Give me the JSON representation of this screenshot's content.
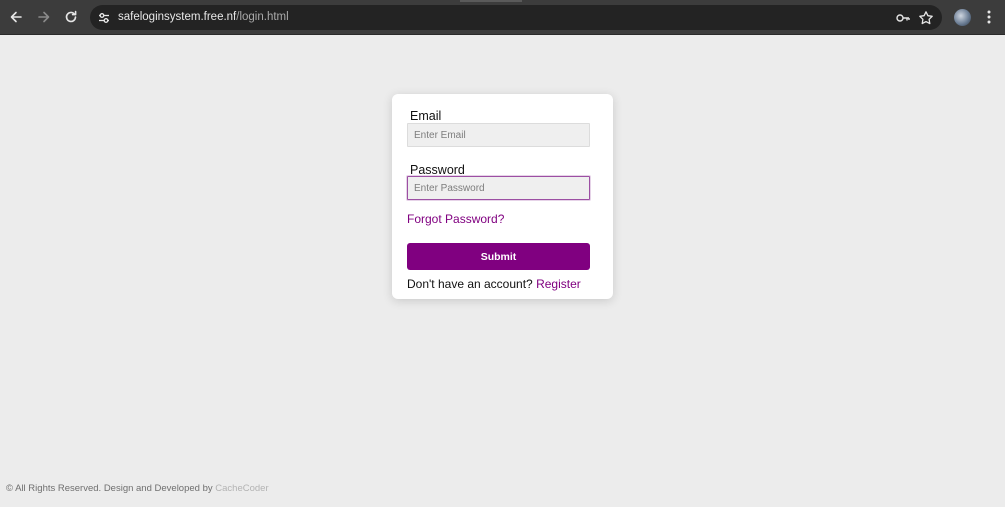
{
  "browser": {
    "url_host": "safeloginsystem.free.nf",
    "url_path": "/login.html",
    "icons": {
      "back": "arrow-left-icon",
      "forward": "arrow-right-icon",
      "reload": "reload-icon",
      "site_info": "tune-icon",
      "password": "key-icon",
      "bookmark": "star-icon",
      "profile": "avatar",
      "menu": "kebab-menu-icon"
    }
  },
  "login": {
    "email_label": "Email",
    "email_placeholder": "Enter Email",
    "email_value": "",
    "password_label": "Password",
    "password_placeholder": "Enter Password",
    "password_value": "",
    "forgot_label": "Forgot Password?",
    "submit_label": "Submit",
    "register_prompt": "Don't have an account?",
    "register_label": "Register"
  },
  "footer": {
    "text": "© All Rights Reserved. Design and Developed by",
    "brand": "CacheCoder"
  },
  "colors": {
    "accent": "#800080",
    "page_bg": "#ececec",
    "chrome_bg": "#3c3c3c"
  }
}
